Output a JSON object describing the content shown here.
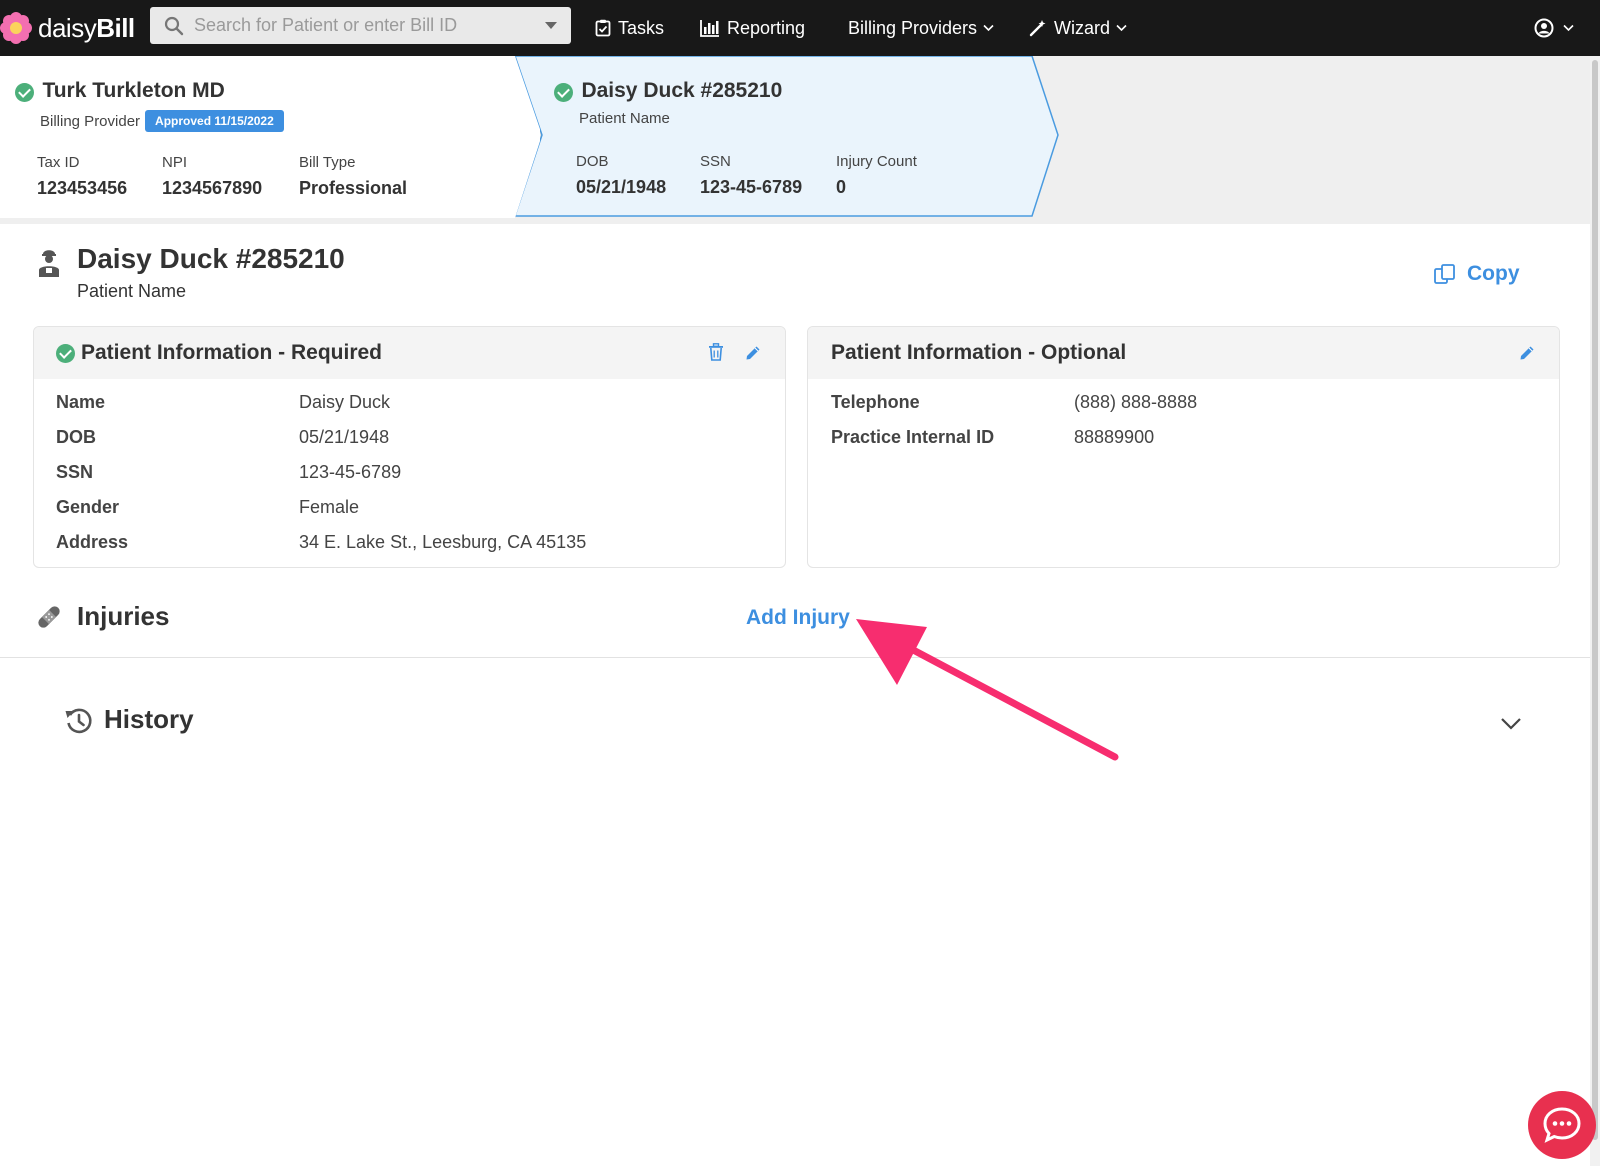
{
  "app": {
    "logo_plain": "daisy",
    "logo_bold": "Bill",
    "search_placeholder": "Search for Patient or enter Bill ID",
    "nav": {
      "tasks": "Tasks",
      "reporting": "Reporting",
      "billing_providers": "Billing Providers",
      "wizard": "Wizard"
    }
  },
  "provider": {
    "name": "Turk Turkleton MD",
    "role": "Billing Provider",
    "badge": "Approved 11/15/2022",
    "fields": [
      {
        "label": "Tax ID",
        "value": "123453456"
      },
      {
        "label": "NPI",
        "value": "1234567890"
      },
      {
        "label": "Bill Type",
        "value": "Professional"
      }
    ]
  },
  "patient_header": {
    "name": "Daisy Duck #285210",
    "role": "Patient Name",
    "fields": [
      {
        "label": "DOB",
        "value": "05/21/1948"
      },
      {
        "label": "SSN",
        "value": "123-45-6789"
      },
      {
        "label": "Injury Count",
        "value": "0"
      }
    ]
  },
  "patient": {
    "title": "Daisy Duck #285210",
    "subtitle": "Patient Name",
    "copy_label": "Copy"
  },
  "required_panel": {
    "title": "Patient Information - Required",
    "rows": [
      {
        "label": "Name",
        "value": "Daisy Duck"
      },
      {
        "label": "DOB",
        "value": "05/21/1948"
      },
      {
        "label": "SSN",
        "value": "123-45-6789"
      },
      {
        "label": "Gender",
        "value": "Female"
      },
      {
        "label": "Address",
        "value": "34 E. Lake St., Leesburg, CA 45135"
      }
    ]
  },
  "optional_panel": {
    "title": "Patient Information - Optional",
    "rows": [
      {
        "label": "Telephone",
        "value": "(888) 888-8888"
      },
      {
        "label": "Practice Internal ID",
        "value": "88889900"
      }
    ]
  },
  "injuries": {
    "title": "Injuries",
    "add_label": "Add Injury"
  },
  "history": {
    "title": "History"
  },
  "colors": {
    "accent": "#3d8fe0",
    "success": "#4caf7a",
    "annotation_arrow": "#f72d6f",
    "navbar": "#181818",
    "chat": "#e8304f"
  }
}
